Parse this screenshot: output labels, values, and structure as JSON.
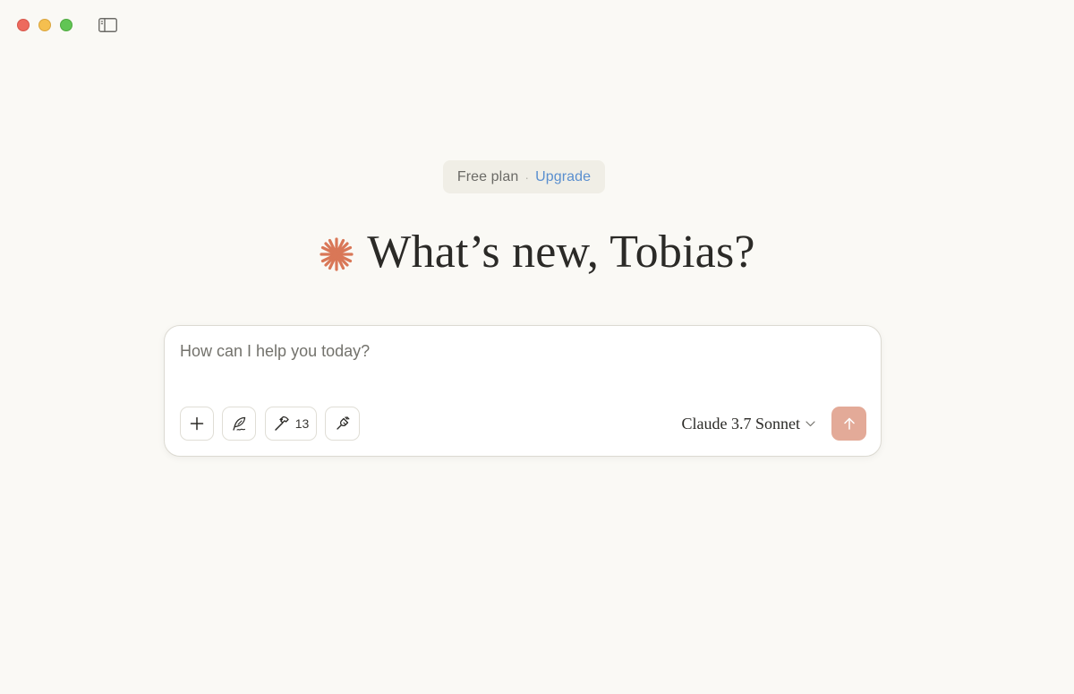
{
  "window": {
    "traffic_lights": [
      "close",
      "minimize",
      "zoom"
    ]
  },
  "plan_badge": {
    "plan_label": "Free plan",
    "separator": "·",
    "upgrade_label": "Upgrade"
  },
  "greeting": {
    "text": "What’s new, Tobias?",
    "icon": "sparkle-icon",
    "icon_color": "#d97757"
  },
  "composer": {
    "placeholder": "How can I help you today?",
    "value": "",
    "toolbar": {
      "add_icon": "plus-icon",
      "style_icon": "feather-pen-icon",
      "tools_icon": "hammer-icon",
      "tools_count": "13",
      "integrations_icon": "plug-icon"
    },
    "model": {
      "label": "Claude 3.7 Sonnet",
      "icon": "chevron-down-icon"
    },
    "send_icon": "arrow-up-icon",
    "send_color": "#e3aa98"
  }
}
